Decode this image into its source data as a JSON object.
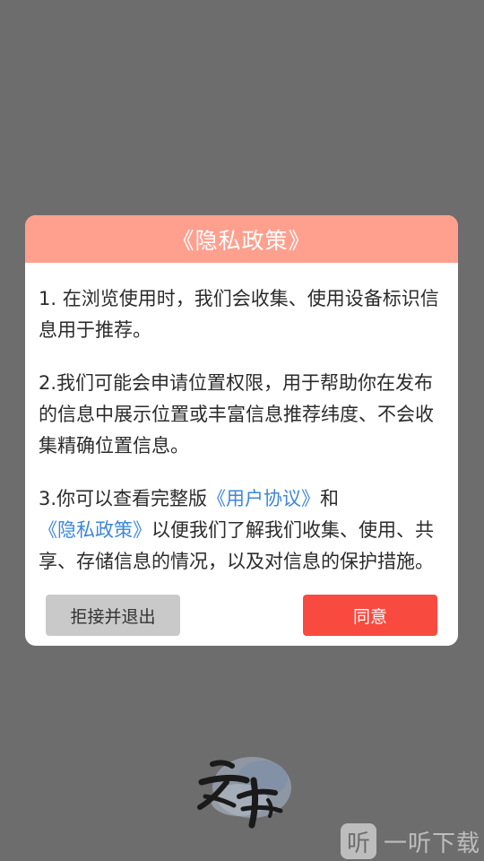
{
  "dialog": {
    "title": "《隐私政策》",
    "paragraphs": [
      {
        "text": "1. 在浏览使用时，我们会收集、使用设备标识信息用于推荐。"
      },
      {
        "text": "2.我们可能会申请位置权限，用于帮助你在发布的信息中展示位置或丰富信息推荐纬度、不会收集精确位置信息。"
      },
      {
        "prefix": "3.你可以查看完整版",
        "link1": "《用户协议》",
        "middle": "和",
        "link2": "《隐私政策》",
        "suffix": "以便我们了解我们收集、使用、共享、存储信息的情况，以及对信息的保护措施。"
      }
    ],
    "reject_label": "拒接并退出",
    "agree_label": "同意"
  },
  "logo": {
    "text": "云书"
  },
  "watermark": {
    "icon_char": "听",
    "text": "一听下载"
  },
  "colors": {
    "header_bg": "#ffa08f",
    "agree_bg": "#f94a3f",
    "reject_bg": "#c9c9c9",
    "link": "#3d87d8",
    "backdrop": "#6d6d6d"
  }
}
